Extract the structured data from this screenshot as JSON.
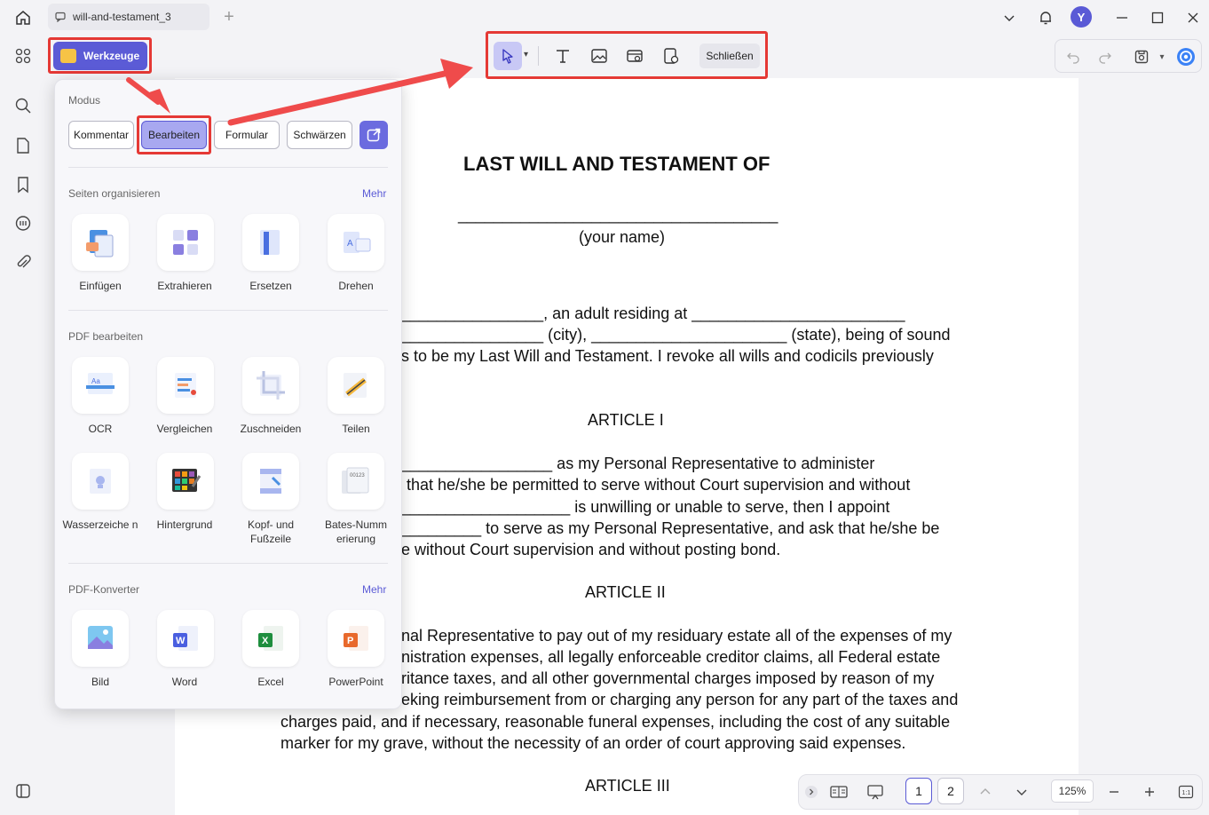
{
  "window": {
    "tab_title": "will-and-testament_3",
    "avatar_initial": "Y"
  },
  "toolbar": {
    "tools_button": "Werkzeuge",
    "close_button": "Schließen"
  },
  "tools_panel": {
    "mode_label": "Modus",
    "modes": [
      "Kommentar",
      "Bearbeiten",
      "Formular",
      "Schwärzen"
    ],
    "active_mode": "Bearbeiten",
    "sections": [
      {
        "title": "Seiten organisieren",
        "more": "Mehr",
        "tools": [
          "Einfügen",
          "Extrahieren",
          "Ersetzen",
          "Drehen"
        ]
      },
      {
        "title": "PDF bearbeiten",
        "more": "",
        "tools": [
          "OCR",
          "Vergleichen",
          "Zuschneiden",
          "Teilen",
          "Wasserzeiche n",
          "Hintergrund",
          "Kopf- und Fußzeile",
          "Bates-Numm erierung"
        ]
      },
      {
        "title": "PDF-Konverter",
        "more": "Mehr",
        "tools": [
          "Bild",
          "Word",
          "Excel",
          "PowerPoint"
        ]
      }
    ]
  },
  "document": {
    "title": "LAST WILL AND TESTAMENT OF",
    "name_line": "____________________________________",
    "name_hint": "(your name)",
    "lines": [
      "________________, an adult residing at ________________________",
      "________________ (city), ______________________ (state), being of sound",
      "s to be my Last Will and Testament. I revoke all wills and codicils previously",
      "ARTICLE I",
      "_________________ as my Personal Representative to administer",
      "that he/she be permitted to serve without Court supervision and without",
      "___________________ is unwilling or unable to serve, then I appoint",
      "_________ to serve as my Personal Representative, and ask that he/she be",
      "e without Court supervision and without posting bond.",
      "ARTICLE II",
      "nal Representative to pay out of my residuary estate all of the expenses of my",
      "nistration expenses, all legally enforceable creditor claims, all Federal estate",
      "ritance taxes, and all other governmental charges imposed by reason of my",
      "eking reimbursement from or charging any person for any part of the taxes and",
      "charges paid, and if necessary, reasonable funeral expenses, including the cost of any suitable",
      "marker for my grave, without the necessity of an order of court approving said expenses.",
      "ARTICLE III"
    ]
  },
  "navigation": {
    "pages": [
      "1",
      "2"
    ],
    "current_page": "1",
    "zoom": "125%"
  },
  "colors": {
    "accent": "#5b5bd6",
    "highlight_red": "#e53935"
  }
}
